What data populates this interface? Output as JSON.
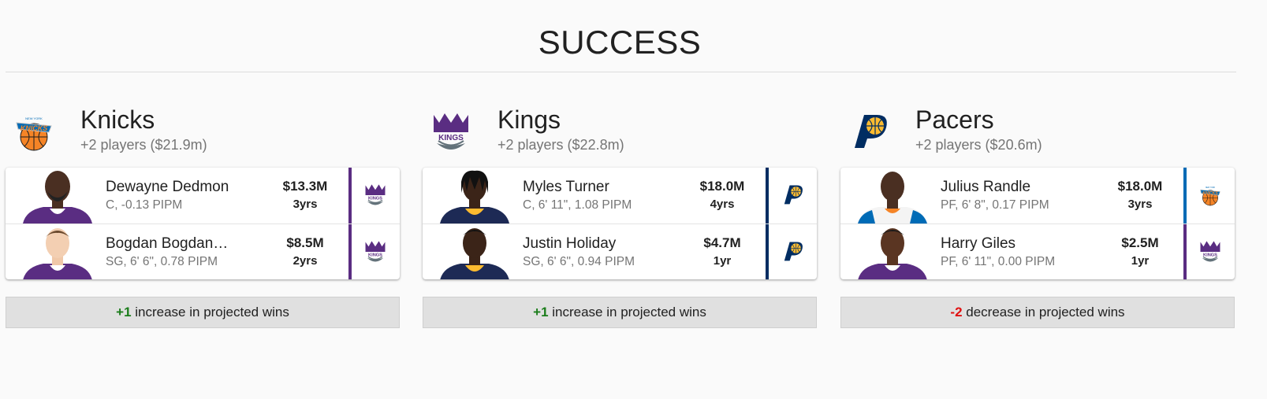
{
  "page": {
    "title": "SUCCESS"
  },
  "colors": {
    "positive": "#1b7d1b",
    "negative": "#e01010",
    "kings_purple": "#5a2d82",
    "pacers_navy": "#002d62",
    "knicks_blue": "#006bb6"
  },
  "teams": [
    {
      "name": "Knicks",
      "summary": "+2 players ($21.9m)",
      "logo": "knicks-logo",
      "players": [
        {
          "name": "Dewayne Dedmon",
          "info": "C, -0.13 PIPM",
          "money": "$13.3M",
          "years": "3yrs",
          "from_logo": "kings-logo"
        },
        {
          "name": "Bogdan Bogdan…",
          "info": "SG, 6' 6\", 0.78 PIPM",
          "money": "$8.5M",
          "years": "2yrs",
          "from_logo": "kings-logo"
        }
      ],
      "result": {
        "delta": "+1",
        "text": " increase in projected wins"
      }
    },
    {
      "name": "Kings",
      "summary": "+2 players ($22.8m)",
      "logo": "kings-logo",
      "players": [
        {
          "name": "Myles Turner",
          "info": "C, 6' 11\", 1.08 PIPM",
          "money": "$18.0M",
          "years": "4yrs",
          "from_logo": "pacers-logo"
        },
        {
          "name": "Justin Holiday",
          "info": "SG, 6' 6\", 0.94 PIPM",
          "money": "$4.7M",
          "years": "1yr",
          "from_logo": "pacers-logo"
        }
      ],
      "result": {
        "delta": "+1",
        "text": " increase in projected wins"
      }
    },
    {
      "name": "Pacers",
      "summary": "+2 players ($20.6m)",
      "logo": "pacers-logo",
      "players": [
        {
          "name": "Julius Randle",
          "info": "PF, 6' 8\", 0.17 PIPM",
          "money": "$18.0M",
          "years": "3yrs",
          "from_logo": "knicks-logo"
        },
        {
          "name": "Harry Giles",
          "info": "PF, 6' 11\", 0.00 PIPM",
          "money": "$2.5M",
          "years": "1yr",
          "from_logo": "kings-logo"
        }
      ],
      "result": {
        "delta": "-2",
        "text": " decrease in projected wins"
      }
    }
  ]
}
